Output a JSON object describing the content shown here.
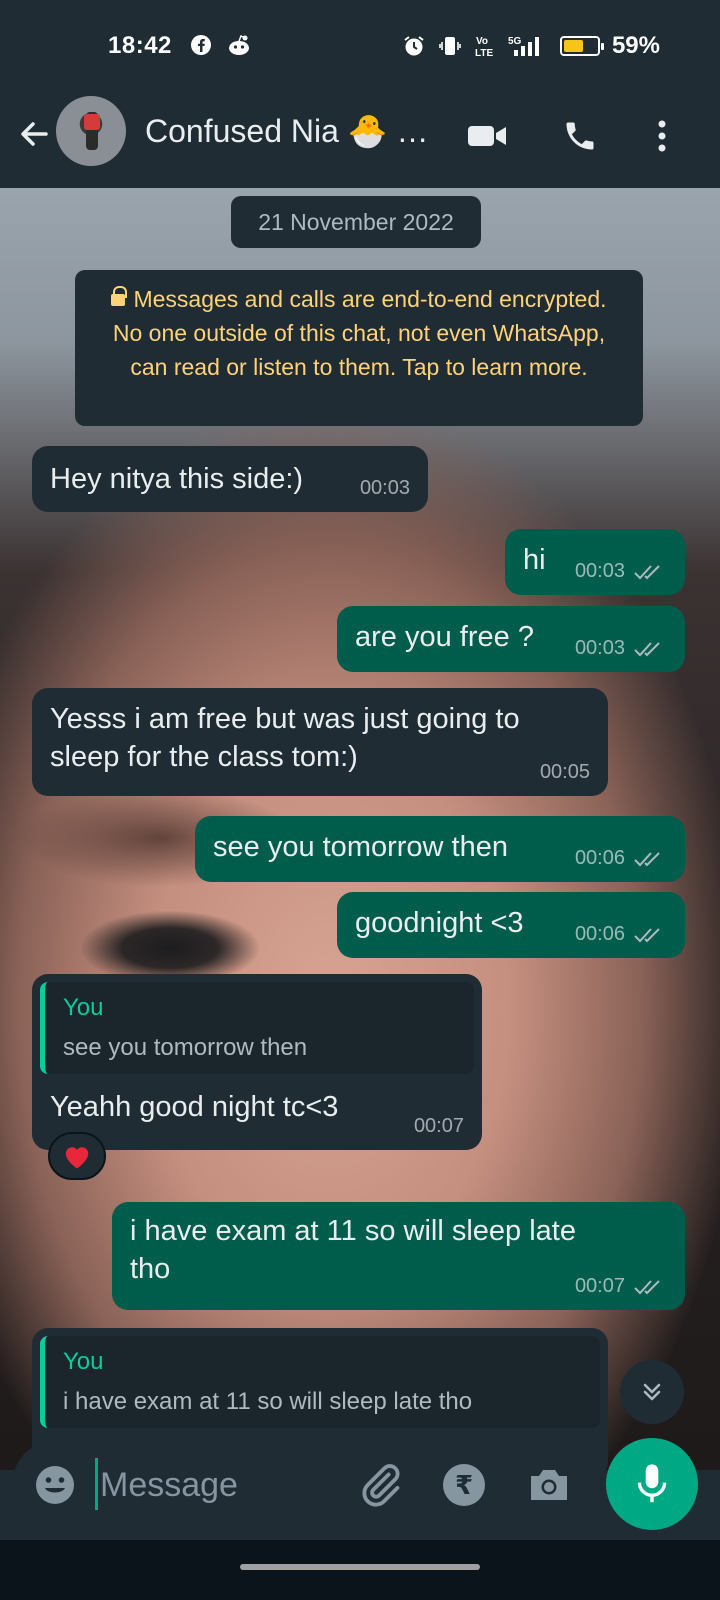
{
  "status_bar": {
    "time": "18:42",
    "left_icons": [
      "facebook-icon",
      "reddit-icon"
    ],
    "right_icons": [
      "alarm-icon",
      "vibrate-icon",
      "volte-icon",
      "5g-signal-icon",
      "battery-icon"
    ],
    "battery_percent": "59%",
    "battery_level": 0.59
  },
  "header": {
    "contact_name": "Confused Nia 🐣 …",
    "icons": [
      "back-arrow-icon",
      "video-call-icon",
      "voice-call-icon",
      "more-options-icon"
    ]
  },
  "chat": {
    "date_chip": "21 November 2022",
    "encryption_notice": "Messages and calls are end-to-end encrypted. No one outside of this chat, not even WhatsApp, can read or listen to them. Tap to learn more.",
    "messages": [
      {
        "direction": "in",
        "text": "Hey nitya this side:)",
        "time": "00:03"
      },
      {
        "direction": "out",
        "text": "hi",
        "time": "00:03",
        "status": "read"
      },
      {
        "direction": "out",
        "text": "are you free ?",
        "time": "00:03",
        "status": "read"
      },
      {
        "direction": "in",
        "text_lines": [
          "Yesss i am free but was just going to",
          "sleep for the class tom:)"
        ],
        "time": "00:05"
      },
      {
        "direction": "out",
        "text": "see you tomorrow then",
        "time": "00:06",
        "status": "read"
      },
      {
        "direction": "out",
        "text": "goodnight <3",
        "time": "00:06",
        "status": "read"
      },
      {
        "direction": "in",
        "quote_author": "You",
        "quote_text": "see you tomorrow then",
        "text": "Yeahh good night tc<3",
        "time": "00:07",
        "reaction": "❤️"
      },
      {
        "direction": "out",
        "text_lines": [
          "i have exam at 11 so will sleep late",
          "tho"
        ],
        "time": "00:07",
        "status": "read"
      },
      {
        "direction": "in",
        "quote_author": "You",
        "quote_text": "i have exam at 11 so will sleep late tho"
      }
    ]
  },
  "composer": {
    "placeholder": "Message",
    "icons": [
      "emoji-icon",
      "attach-icon",
      "rupee-payment-icon",
      "camera-icon",
      "microphone-icon"
    ]
  },
  "colors": {
    "header_bg": "#1f2c34",
    "outgoing_bubble": "#005c4b",
    "incoming_bubble": "#1f2c34",
    "accent": "#00a884",
    "encryption_text": "#ffd279",
    "quote_accent": "#06cf9c"
  }
}
